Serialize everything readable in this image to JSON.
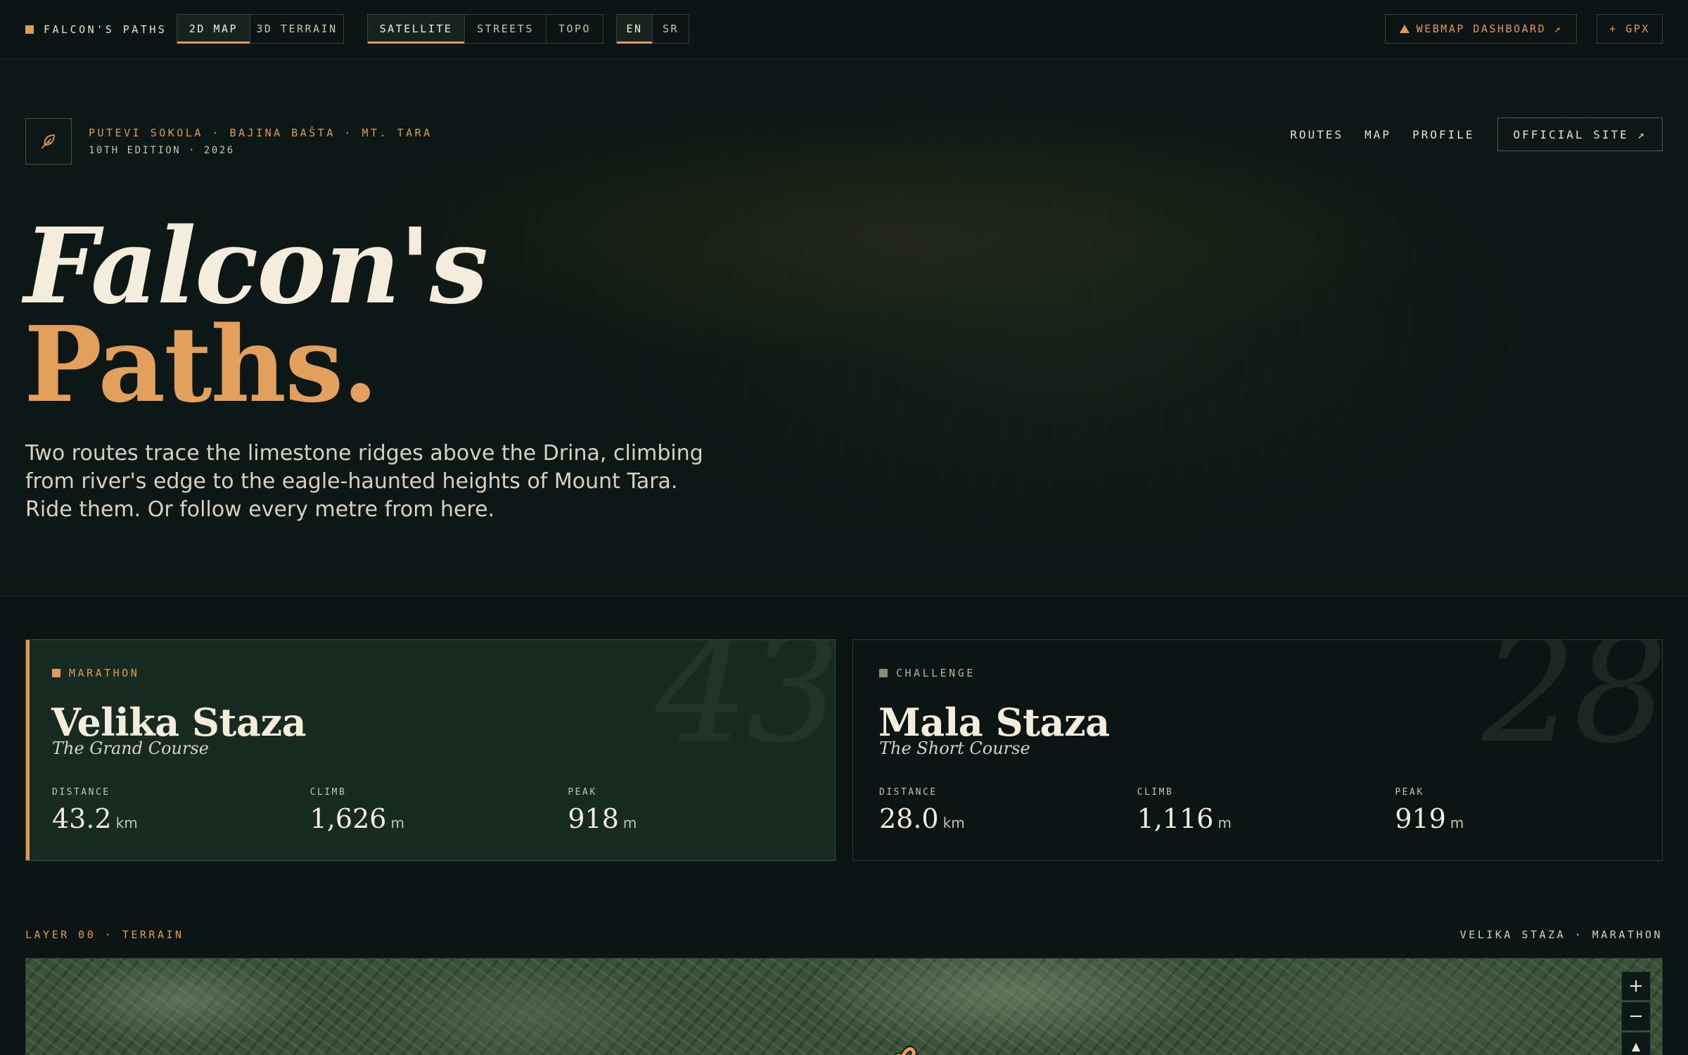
{
  "toolbar": {
    "brand": "FALCON'S PATHS",
    "view_modes": [
      {
        "label": "2D MAP",
        "active": true
      },
      {
        "label": "3D TERRAIN",
        "active": false
      }
    ],
    "basemaps": [
      {
        "label": "SATELLITE",
        "active": true
      },
      {
        "label": "STREETS",
        "active": false
      },
      {
        "label": "TOPO",
        "active": false
      }
    ],
    "languages": [
      {
        "label": "EN",
        "active": true
      },
      {
        "label": "SR",
        "active": false
      }
    ],
    "dashboard_label": "WEBMAP DASHBOARD ↗",
    "gpx_label": "+ GPX"
  },
  "hero": {
    "eyebrow": "PUTEVI SOKOLA · BAJINA BAŠTA · MT. TARA",
    "edition": "10TH EDITION · 2026",
    "nav": [
      "ROUTES",
      "MAP",
      "PROFILE"
    ],
    "official_site_label": "OFFICIAL SITE ↗",
    "title_line1": "Falcon's",
    "title_line2": "Paths.",
    "lede": "Two routes trace the limestone ridges above the Drina, climbing from river's edge to the eagle-haunted heights of Mount Tara. Ride them. Or follow every metre from here."
  },
  "routes": [
    {
      "tag": "MARATHON",
      "name": "Velika Staza",
      "subtitle": "The Grand Course",
      "big_number": "43",
      "selected": true,
      "stats": [
        {
          "label": "DISTANCE",
          "value": "43.2",
          "unit": "km"
        },
        {
          "label": "CLIMB",
          "value": "1,626",
          "unit": "m"
        },
        {
          "label": "PEAK",
          "value": "918",
          "unit": "m"
        }
      ]
    },
    {
      "tag": "CHALLENGE",
      "name": "Mala Staza",
      "subtitle": "The Short Course",
      "big_number": "28",
      "selected": false,
      "stats": [
        {
          "label": "DISTANCE",
          "value": "28.0",
          "unit": "km"
        },
        {
          "label": "CLIMB",
          "value": "1,116",
          "unit": "m"
        },
        {
          "label": "PEAK",
          "value": "919",
          "unit": "m"
        }
      ]
    }
  ],
  "map_section": {
    "layer_label": "LAYER 00 · TERRAIN",
    "route_label": "VELIKA STAZA · MARATHON",
    "controls": {
      "zoom_in": "+",
      "zoom_out": "−",
      "north": "▲"
    }
  },
  "colors": {
    "accent": "#e09a56",
    "background": "#0c1513",
    "card_selected": "#182b22",
    "text": "#e9e2d0"
  },
  "icons": {
    "brand": "orange-square-icon",
    "logo": "feather-icon",
    "dashboard": "triangle-icon"
  }
}
